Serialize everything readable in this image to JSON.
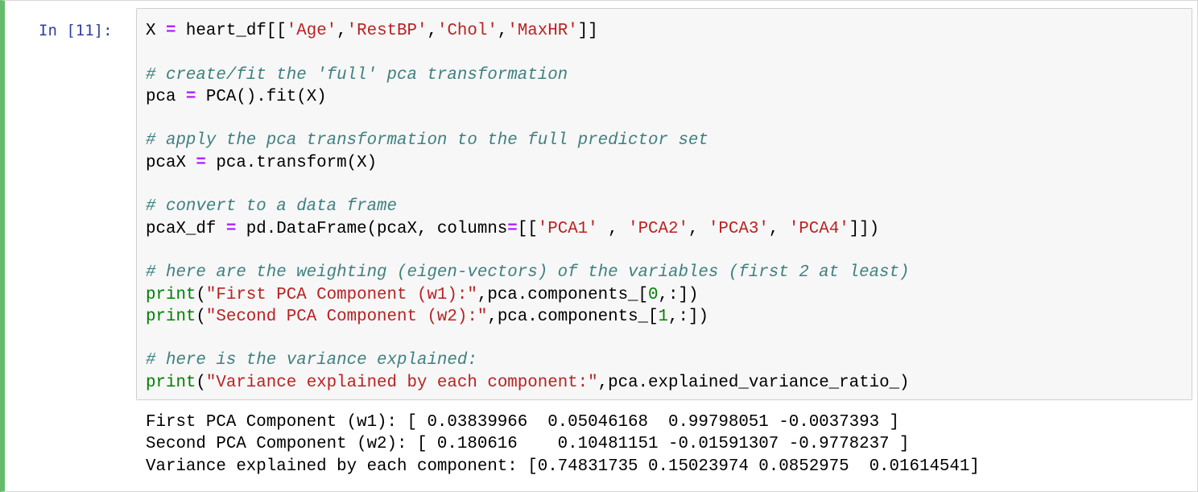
{
  "cell": {
    "prompt": "In [11]:",
    "code_lines": [
      [
        {
          "t": "X "
        },
        {
          "t": "=",
          "c": "op"
        },
        {
          "t": " heart_df[["
        },
        {
          "t": "'Age'",
          "c": "str"
        },
        {
          "t": ","
        },
        {
          "t": "'RestBP'",
          "c": "str"
        },
        {
          "t": ","
        },
        {
          "t": "'Chol'",
          "c": "str"
        },
        {
          "t": ","
        },
        {
          "t": "'MaxHR'",
          "c": "str"
        },
        {
          "t": "]]"
        }
      ],
      [],
      [
        {
          "t": "# create/fit the 'full' pca transformation",
          "c": "cm"
        }
      ],
      [
        {
          "t": "pca "
        },
        {
          "t": "=",
          "c": "op"
        },
        {
          "t": " PCA().fit(X)"
        }
      ],
      [],
      [
        {
          "t": "# apply the pca transformation to the full predictor set",
          "c": "cm"
        }
      ],
      [
        {
          "t": "pcaX "
        },
        {
          "t": "=",
          "c": "op"
        },
        {
          "t": " pca.transform(X)"
        }
      ],
      [],
      [
        {
          "t": "# convert to a data frame",
          "c": "cm"
        }
      ],
      [
        {
          "t": "pcaX_df "
        },
        {
          "t": "=",
          "c": "op"
        },
        {
          "t": " pd.DataFrame(pcaX, columns"
        },
        {
          "t": "=",
          "c": "op"
        },
        {
          "t": "[["
        },
        {
          "t": "'PCA1'",
          "c": "str"
        },
        {
          "t": " , "
        },
        {
          "t": "'PCA2'",
          "c": "str"
        },
        {
          "t": ", "
        },
        {
          "t": "'PCA3'",
          "c": "str"
        },
        {
          "t": ", "
        },
        {
          "t": "'PCA4'",
          "c": "str"
        },
        {
          "t": "]])"
        }
      ],
      [],
      [
        {
          "t": "# here are the weighting (eigen-vectors) of the variables (first 2 at least)",
          "c": "cm"
        }
      ],
      [
        {
          "t": "print",
          "c": "bi"
        },
        {
          "t": "("
        },
        {
          "t": "\"First PCA Component (w1):\"",
          "c": "str"
        },
        {
          "t": ",pca.components_["
        },
        {
          "t": "0",
          "c": "num"
        },
        {
          "t": ",:])"
        }
      ],
      [
        {
          "t": "print",
          "c": "bi"
        },
        {
          "t": "("
        },
        {
          "t": "\"Second PCA Component (w2):\"",
          "c": "str"
        },
        {
          "t": ",pca.components_["
        },
        {
          "t": "1",
          "c": "num"
        },
        {
          "t": ",:])"
        }
      ],
      [],
      [
        {
          "t": "# here is the variance explained:",
          "c": "cm"
        }
      ],
      [
        {
          "t": "print",
          "c": "bi"
        },
        {
          "t": "("
        },
        {
          "t": "\"Variance explained by each component:\"",
          "c": "str"
        },
        {
          "t": ",pca.explained_variance_ratio_)"
        }
      ]
    ],
    "output_lines": [
      "First PCA Component (w1): [ 0.03839966  0.05046168  0.99798051 -0.0037393 ]",
      "Second PCA Component (w2): [ 0.180616    0.10481151 -0.01591307 -0.9778237 ]",
      "Variance explained by each component: [0.74831735 0.15023974 0.0852975  0.01614541]"
    ]
  },
  "colors": {
    "selected_border": "#66bb6a",
    "prompt": "#303f9f",
    "operator": "#aa22ff",
    "string": "#ba2121",
    "number": "#008000",
    "builtin": "#008000",
    "comment": "#408080",
    "input_background": "#f7f7f7"
  }
}
